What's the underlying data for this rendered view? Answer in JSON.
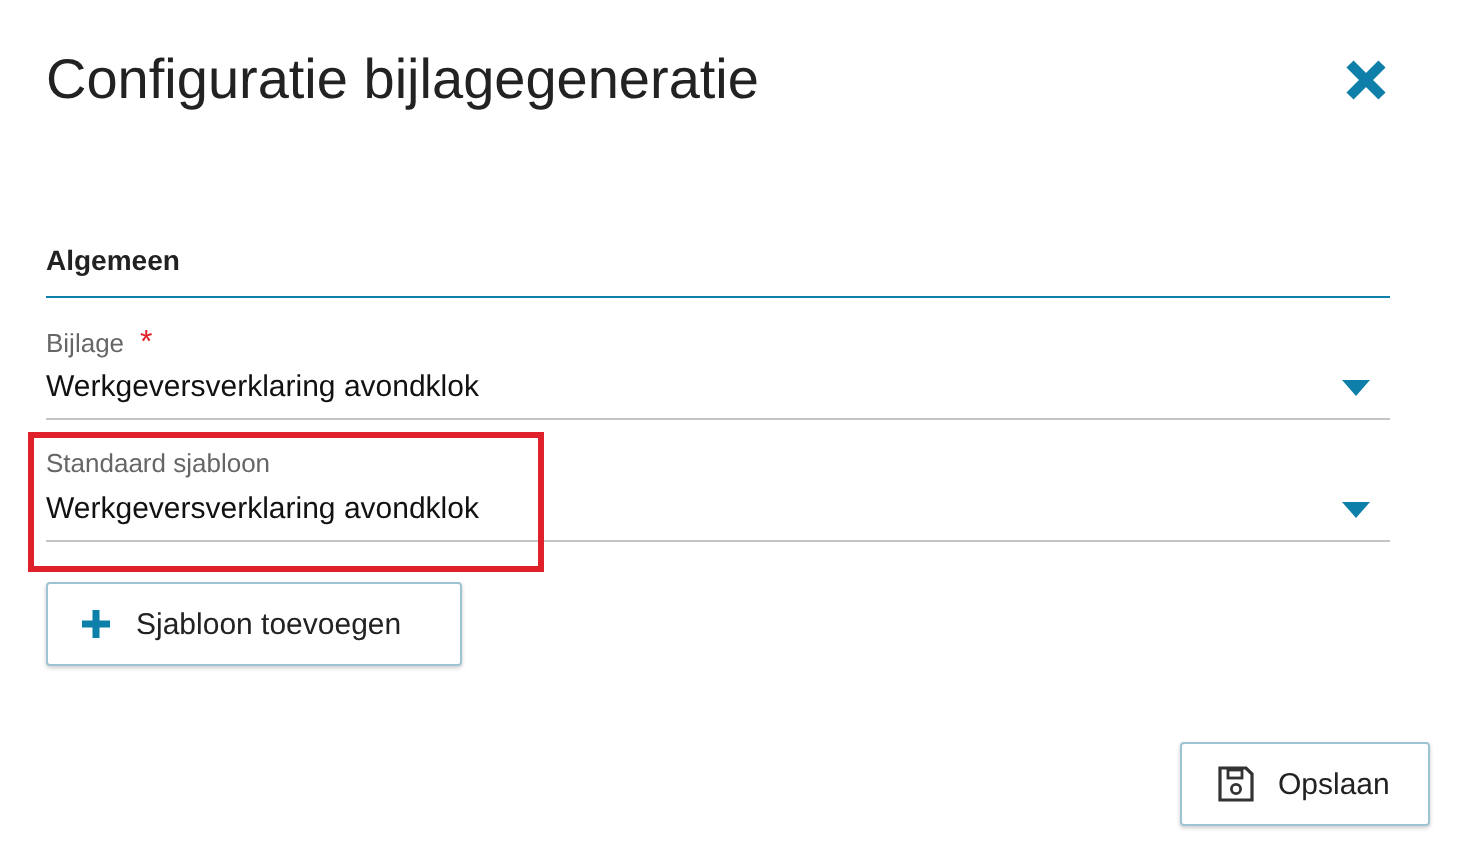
{
  "dialog": {
    "title": "Configuratie bijlagegeneratie"
  },
  "section": {
    "title": "Algemeen"
  },
  "fields": [
    {
      "label": "Bijlage",
      "required": true,
      "value": "Werkgeversverklaring avondklok",
      "highlighted": false
    },
    {
      "label": "Standaard sjabloon",
      "required": false,
      "value": "Werkgeversverklaring avondklok",
      "highlighted": true
    }
  ],
  "add_button": {
    "label": "Sjabloon toevoegen"
  },
  "save_button": {
    "label": "Opslaan"
  },
  "required_mark": "*"
}
